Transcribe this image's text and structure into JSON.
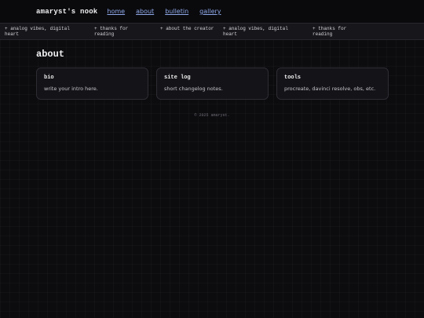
{
  "nav": {
    "brand": "amaryst's nook",
    "links": [
      "home",
      "about",
      "bulletin",
      "gallery"
    ]
  },
  "ticker": {
    "items": [
      "+ analog vibes, digital heart",
      "+ thanks for reading",
      "+ about the creator",
      "+ analog vibes, digital heart",
      "+ thanks for reading"
    ]
  },
  "main": {
    "title": "about",
    "cards": [
      {
        "title": "bio",
        "text": "write your intro here."
      },
      {
        "title": "site log",
        "text": "short changelog notes."
      },
      {
        "title": "tools",
        "text": "procreate, davinci resolve, obs, etc."
      }
    ]
  },
  "footer": {
    "text": "© 2025 amaryst."
  },
  "colors": {
    "background": "#0c0c0f",
    "link": "#8fa8e8",
    "card_bg": "#141418",
    "card_border": "#2c2c33"
  }
}
